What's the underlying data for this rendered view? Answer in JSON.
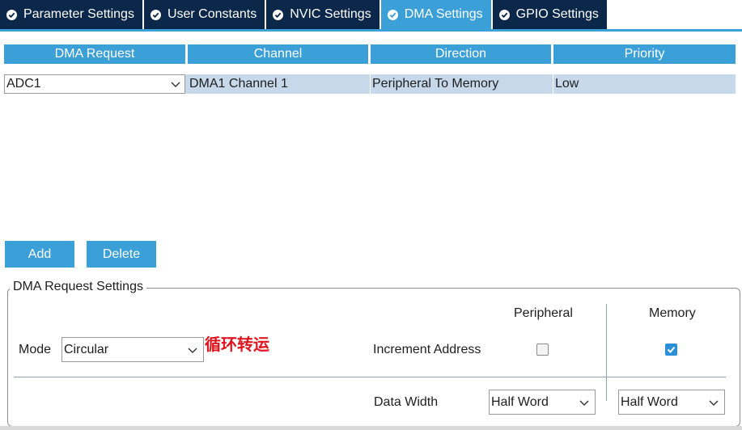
{
  "tabs": [
    {
      "label": "Parameter Settings",
      "active": false
    },
    {
      "label": "User Constants",
      "active": false
    },
    {
      "label": "NVIC Settings",
      "active": false
    },
    {
      "label": "DMA Settings",
      "active": true
    },
    {
      "label": "GPIO Settings",
      "active": false
    }
  ],
  "table": {
    "columns": [
      "DMA Request",
      "Channel",
      "Direction",
      "Priority"
    ],
    "rows": [
      {
        "request": "ADC1",
        "channel": "DMA1 Channel 1",
        "direction": "Peripheral To Memory",
        "priority": "Low"
      }
    ]
  },
  "buttons": {
    "add": "Add",
    "delete": "Delete"
  },
  "settings": {
    "legend": "DMA Request Settings",
    "mode_label": "Mode",
    "mode_value": "Circular",
    "annotation": "循环转运",
    "peripheral_header": "Peripheral",
    "memory_header": "Memory",
    "increment_label": "Increment Address",
    "peripheral_increment": false,
    "memory_increment": true,
    "data_width_label": "Data Width",
    "peripheral_width": "Half Word",
    "memory_width": "Half Word"
  },
  "colors": {
    "tab_dark": "#0b2749",
    "accent": "#3b9fd8",
    "row_selected": "#c7d8eb",
    "annotation": "#e0141e"
  },
  "icons": {
    "tab_status": "check-circle-icon",
    "dropdown": "chevron-down-icon",
    "checked": "checkmark-icon"
  }
}
